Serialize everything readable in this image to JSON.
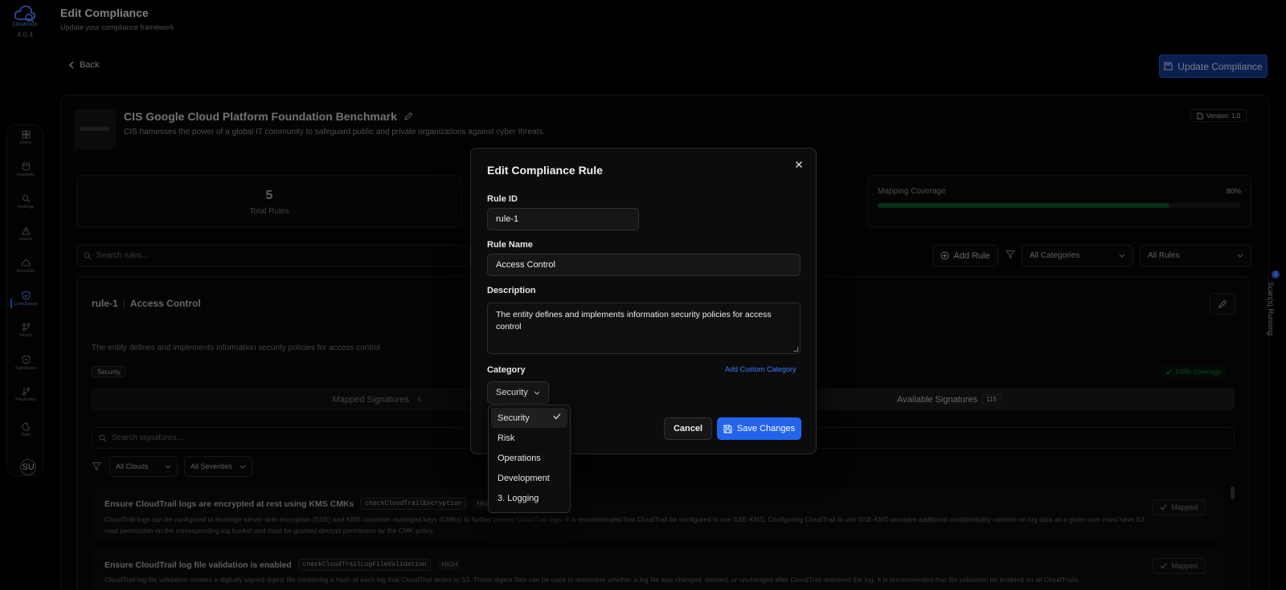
{
  "app": {
    "brand": "Cloudnosys",
    "version": "4.0.4"
  },
  "sidebar": {
    "items": [
      {
        "label": "Home",
        "icon": "home-icon"
      },
      {
        "label": "Inventory",
        "icon": "database-icon"
      },
      {
        "label": "Findings",
        "icon": "search-icon"
      },
      {
        "label": "Issues",
        "icon": "warning-icon"
      },
      {
        "label": "Accounts",
        "icon": "cloud-icon"
      },
      {
        "label": "Compliance",
        "icon": "shield-icon"
      },
      {
        "label": "Graph",
        "icon": "graph-icon"
      },
      {
        "label": "Signatures",
        "icon": "shield-check-icon"
      },
      {
        "label": "Playbooks",
        "icon": "git-branch-icon"
      },
      {
        "label": "Dark",
        "icon": "moon-icon"
      }
    ],
    "avatar": "SU"
  },
  "header": {
    "title": "Edit Compliance",
    "subtitle": "Update your compliance framework",
    "back_label": "Back",
    "update_label": "Update Compliance"
  },
  "framework": {
    "title": "CIS Google Cloud Platform Foundation Benchmark",
    "description": "CIS harnesses the power of a global IT community to safeguard public and private organizations against cyber threats.",
    "version": "Version: 1.0"
  },
  "stats": {
    "total_rules_value": "5",
    "total_rules_label": "Total Rules",
    "coverage_label": "Mapping Coverage",
    "coverage_percent_text": "80%",
    "coverage_fraction": 0.8
  },
  "toolbar": {
    "search_placeholder": "Search rules...",
    "add_rule_label": "Add Rule",
    "category_filter": "All Categories",
    "rules_filter": "All Rules"
  },
  "rule": {
    "id": "rule-1",
    "name": "Access Control",
    "description": "The entity defines and implements information security policies for access control",
    "category_chip": "Security",
    "coverage_chip": "100% Coverage",
    "mapped_tab": "Mapped Signatures",
    "mapped_count": "4",
    "available_tab": "Available Signatures",
    "available_count": "115",
    "sig_search_placeholder": "Search signatures...",
    "cloud_filter": "All Clouds",
    "severity_filter": "All Severities"
  },
  "signatures": [
    {
      "title": "Ensure CloudTrail logs are encrypted at rest using KMS CMKs",
      "code": "checkCloudTrailEncryption",
      "severity": "HIGH",
      "body": "CloudTrail logs can be configured to leverage server-side encryption (SSE) and KMS customer managed keys (CMKs) to further protect CloudTrail logs. It is recommended that CloudTrail be configured to use SSE-KMS. Configuring CloudTrail to use SSE-KMS provides additional confidentiality controls on log data as a given user must have S3 read permission on the corresponding log bucket and must be granted decrypt permission by the CMK policy.",
      "status": "Mapped"
    },
    {
      "title": "Ensure CloudTrail log file validation is enabled",
      "code": "checkCloudTrailLogFileValidation",
      "severity": "HIGH",
      "body": "CloudTrail log file validation creates a digitally signed digest file containing a hash of each log that CloudTrail writes to S3. These digest files can be used to determine whether a log file was changed, deleted, or unchanged after CloudTrail delivered the log. It is recommended that file validation be enabled on all CloudTrails.",
      "status": "Mapped"
    }
  ],
  "scans": {
    "label": "Scan(s) Running",
    "count": "1"
  },
  "modal": {
    "title": "Edit Compliance Rule",
    "rule_id_label": "Rule ID",
    "rule_id_value": "rule-1",
    "rule_name_label": "Rule Name",
    "rule_name_value": "Access Control",
    "description_label": "Description",
    "description_value": "The entity defines and implements information security policies for access control",
    "category_label": "Category",
    "add_custom_category": "Add Custom Category",
    "category_value": "Security",
    "cancel_label": "Cancel",
    "save_label": "Save Changes",
    "options": [
      "Security",
      "Risk",
      "Operations",
      "Development",
      "3. Logging"
    ],
    "selected_option": "Security"
  },
  "colors": {
    "accent": "#2463eb",
    "success": "#1f8a45",
    "background": "#000000"
  }
}
